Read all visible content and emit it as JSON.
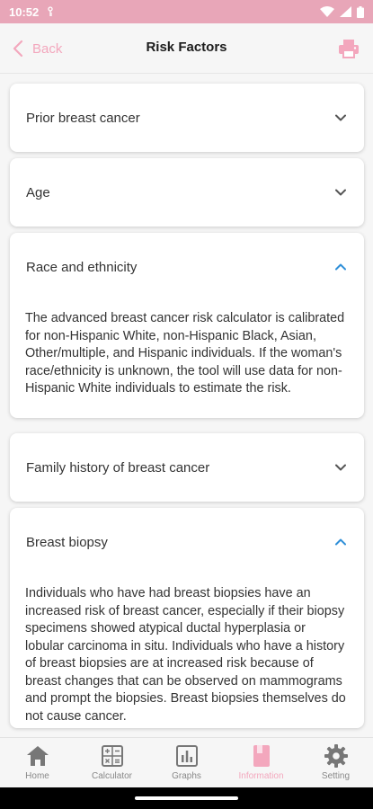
{
  "status_bar": {
    "time": "10:52"
  },
  "app_bar": {
    "back_label": "Back",
    "title": "Risk Factors",
    "print_icon": "print-icon"
  },
  "colors": {
    "accent": "#f3a7bd",
    "status_bar": "#e8a6b8",
    "chevron_collapsed": "#555555",
    "chevron_expanded": "#2f8fd8"
  },
  "cards": [
    {
      "label": "Prior breast cancer",
      "expanded": false
    },
    {
      "label": "Age",
      "expanded": false
    },
    {
      "label": "Race and ethnicity",
      "expanded": true,
      "body": "The advanced breast cancer risk calculator is calibrated for non-Hispanic White, non-Hispanic Black, Asian, Other/multiple, and Hispanic individuals. If the woman's race/ethnicity is unknown, the tool will use data for non-Hispanic White individuals to estimate the risk."
    },
    {
      "label": "Family history of breast cancer",
      "expanded": false
    },
    {
      "label": "Breast biopsy",
      "expanded": true,
      "body": "Individuals who have had breast biopsies have an increased risk of breast cancer, especially if their biopsy specimens showed atypical ductal hyperplasia or lobular carcinoma in situ. Individuals who have a history of breast biopsies are at increased risk because of breast changes that can be observed on mammograms and prompt the biopsies. Breast biopsies themselves do not cause cancer."
    }
  ],
  "bottom_nav": [
    {
      "label": "Home",
      "icon": "home-icon",
      "active": false
    },
    {
      "label": "Calculator",
      "icon": "calculator-icon",
      "active": false
    },
    {
      "label": "Graphs",
      "icon": "graphs-icon",
      "active": false
    },
    {
      "label": "Information",
      "icon": "information-icon",
      "active": true
    },
    {
      "label": "Setting",
      "icon": "gear-icon",
      "active": false
    }
  ]
}
